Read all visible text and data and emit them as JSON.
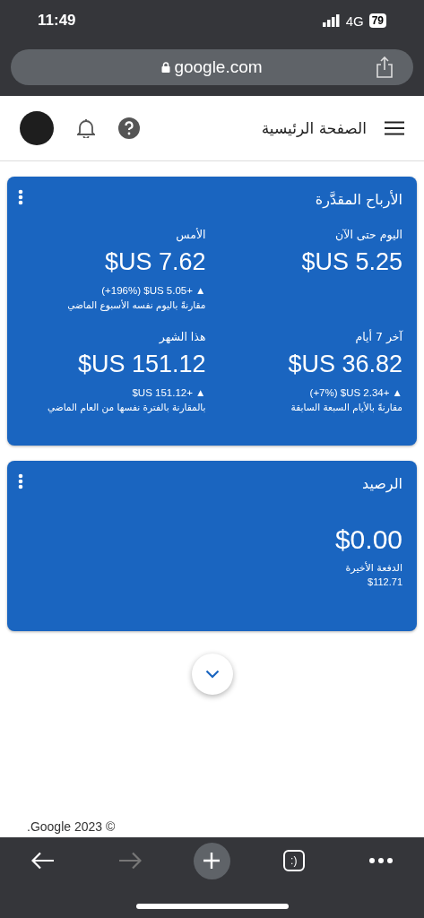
{
  "status_bar": {
    "time": "11:49",
    "network": "4G",
    "battery": "79"
  },
  "browser": {
    "url": "google.com"
  },
  "header": {
    "title": "الصفحة الرئيسية"
  },
  "earnings": {
    "title": "الأرباح المقدَّرة",
    "metrics": [
      {
        "label": "اليوم حتى الآن",
        "value": "$US 5.25"
      },
      {
        "label": "الأمس",
        "value": "$US 7.62",
        "change": "(+196%) $US 5.05+ ▲",
        "note": "مقارنةً باليوم نفسه الأسبوع الماضي"
      },
      {
        "label": "آخر 7 أيام",
        "value": "$US 36.82",
        "change": "(+7%) $US 2.34+ ▲",
        "note": "مقارنةً بالأيام السبعة السابقة"
      },
      {
        "label": "هذا الشهر",
        "value": "$US 151.12",
        "change": "$US 151.12+ ▲",
        "note": "بالمقارنة بالفترة نفسها من العام الماضي"
      }
    ]
  },
  "balance": {
    "title": "الرصيد",
    "value": "$0.00",
    "last_payment_label": "الدفعة الأخيرة",
    "last_payment": "$112.71"
  },
  "footer": {
    "copyright": ".Google 2023 ©"
  },
  "toolbar": {
    "items": [
      {
        "kind": "back",
        "disabled": false
      },
      {
        "kind": "forward",
        "disabled": true
      },
      {
        "kind": "new-tab",
        "disabled": false
      },
      {
        "kind": "tabs",
        "text": ":)",
        "disabled": false
      },
      {
        "kind": "more",
        "disabled": false
      }
    ]
  }
}
